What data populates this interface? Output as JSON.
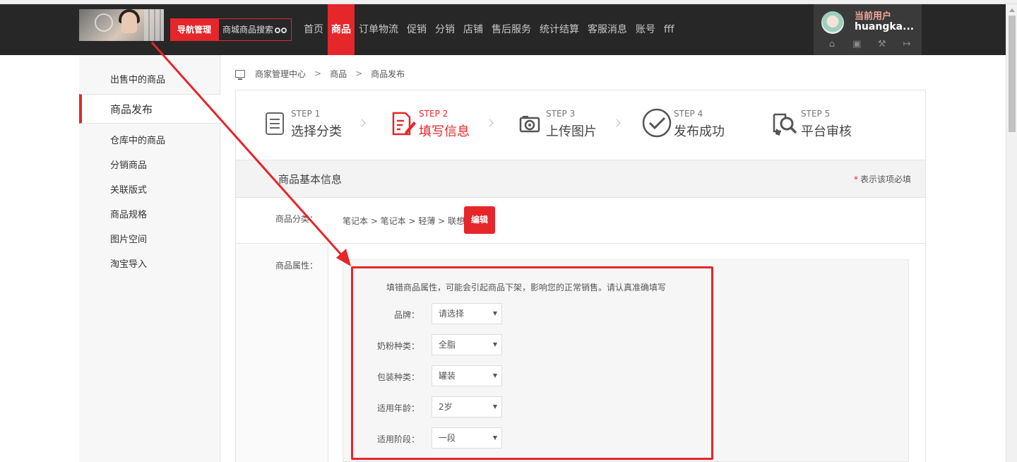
{
  "header": {
    "nav_manage": "导航管理",
    "mall_search": "商城商品搜索",
    "nav_items": [
      "首页",
      "商品",
      "订单物流",
      "促销",
      "分销",
      "店铺",
      "售后服务",
      "统计结算",
      "客服消息",
      "账号",
      "fff"
    ],
    "active_nav": "商品",
    "user_title": "当前用户",
    "user_name": "huangka...",
    "user_icons": [
      "home-icon",
      "store-icon",
      "wrench-icon",
      "logout-icon"
    ]
  },
  "sidebar": {
    "items": [
      "出售中的商品",
      "商品发布",
      "仓库中的商品",
      "分销商品",
      "关联版式",
      "商品规格",
      "图片空间",
      "淘宝导入"
    ],
    "active": "商品发布"
  },
  "breadcrumb": [
    "商家管理中心",
    "商品",
    "商品发布"
  ],
  "steps": [
    {
      "label": "STEP 1",
      "title": "选择分类",
      "icon": "list-icon",
      "active": false
    },
    {
      "label": "STEP 2",
      "title": "填写信息",
      "icon": "edit-icon",
      "active": true
    },
    {
      "label": "STEP 3",
      "title": "上传图片",
      "icon": "camera-icon",
      "active": false
    },
    {
      "label": "STEP 4",
      "title": "发布成功",
      "icon": "check-circle-icon",
      "active": false
    },
    {
      "label": "STEP 5",
      "title": "平台审核",
      "icon": "review-icon",
      "active": false
    }
  ],
  "form": {
    "section_title": "商品基本信息",
    "required_note": "表示该项必填",
    "category_label": "商品分类：",
    "category_path": "笔记本 > 笔记本 > 轻薄 > 联想",
    "edit_button": "编辑",
    "attributes_label": "商品属性：",
    "attributes_warning": "填错商品属性，可能会引起商品下架，影响您的正常销售。请认真准确填写",
    "attributes": [
      {
        "label": "品牌：",
        "value": "请选择"
      },
      {
        "label": "奶粉种类：",
        "value": "全脂"
      },
      {
        "label": "包装种类：",
        "value": "罐装"
      },
      {
        "label": "适用年龄：",
        "value": "2岁"
      },
      {
        "label": "适用阶段：",
        "value": "一段"
      }
    ]
  },
  "colors": {
    "accent": "#e5262b",
    "header_bg": "#272727"
  }
}
